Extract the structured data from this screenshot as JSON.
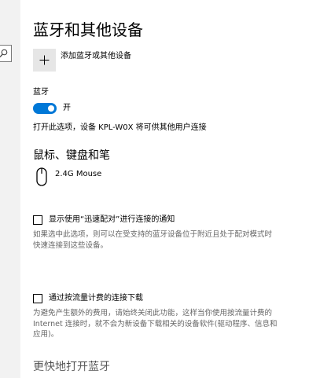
{
  "nav": {
    "search_icon": "search-icon"
  },
  "page": {
    "title": "蓝牙和其他设备"
  },
  "add_device": {
    "icon": "plus-icon",
    "label": "添加蓝牙或其他设备"
  },
  "bluetooth": {
    "label": "蓝牙",
    "toggle_state": "开",
    "toggle_on": true,
    "toggle_color": "#0078d7",
    "discoverable_text": "打开此选项，设备 KPL-W0X 将可供其他用户连接"
  },
  "peripherals": {
    "title": "鼠标、键盘和笔",
    "devices": [
      {
        "icon": "mouse-icon",
        "name": "2.4G Mouse"
      }
    ]
  },
  "swift_pair": {
    "checked": false,
    "label": "显示使用“迅速配对”进行连接的通知",
    "description": "如果选中此选项，则可以在受支持的蓝牙设备位于附近且处于配对模式时快速连接到这些设备。"
  },
  "metered": {
    "checked": false,
    "label": "通过按流量计费的连接下载",
    "description": "为避免产生额外的费用，请始终关闭此功能，这样当你使用按流量计费的 Internet 连接时，就不会为新设备下载相关的设备软件(驱动程序、信息和应用)。"
  },
  "faster_bt": {
    "title": "更快地打开蓝牙"
  }
}
